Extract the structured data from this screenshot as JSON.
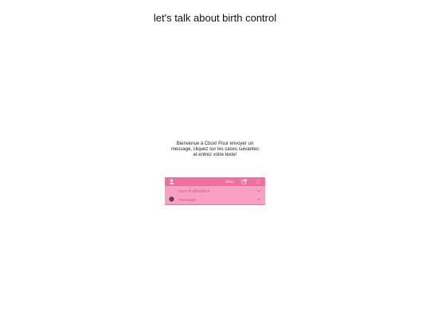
{
  "page": {
    "title": "let's talk about birth control"
  },
  "cbox": {
    "welcome_lines": [
      "Bienvenue à Cbox! Pour envoyer un",
      "message, cliquez sur les cases suivantes",
      "et entrez votre texte!"
    ],
    "brand": "Cbox",
    "name_placeholder": "nom d'utilisateur",
    "message_placeholder": "message",
    "icons": {
      "user": "user-icon",
      "popout": "popout-icon",
      "settings": "settings-icon",
      "smiley": "smiley-icon",
      "chevron": "chevron-icon"
    },
    "colors": {
      "bar": "#f06f9f",
      "body": "#f9a0c4",
      "placeholder": "#c2658c"
    }
  }
}
